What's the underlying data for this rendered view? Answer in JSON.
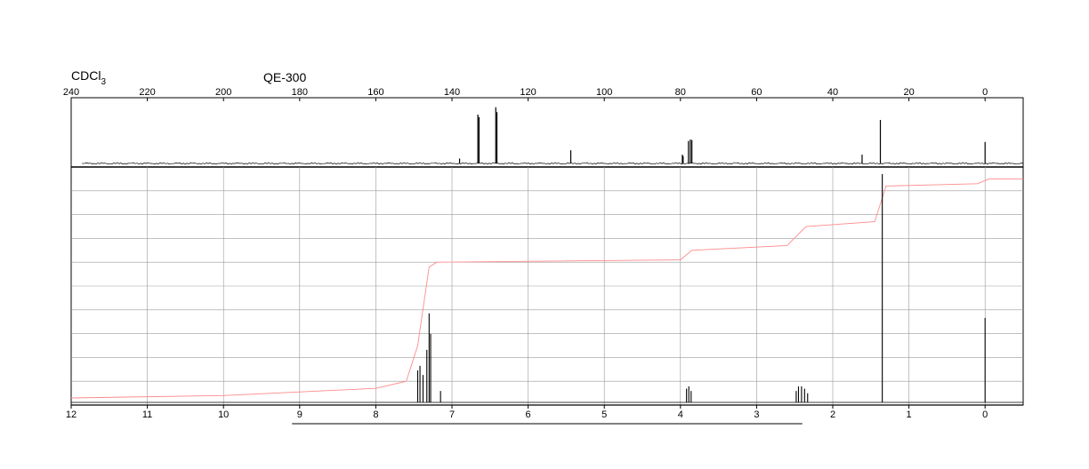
{
  "chart_data": [
    {
      "type": "line",
      "title": "",
      "xlabel": "",
      "ylabel": "",
      "xlim": [
        240,
        -10
      ],
      "x_ticks": [
        240,
        220,
        200,
        180,
        160,
        140,
        120,
        100,
        80,
        60,
        40,
        20,
        0
      ],
      "grid": false,
      "peaks": [
        {
          "x": 138.0,
          "h": 0.1
        },
        {
          "x": 133.2,
          "h": 1.0
        },
        {
          "x": 132.9,
          "h": 0.95
        },
        {
          "x": 128.5,
          "h": 1.15
        },
        {
          "x": 128.2,
          "h": 1.05
        },
        {
          "x": 108.8,
          "h": 0.27
        },
        {
          "x": 79.5,
          "h": 0.18
        },
        {
          "x": 79.3,
          "h": 0.15
        },
        {
          "x": 77.9,
          "h": 0.46
        },
        {
          "x": 77.4,
          "h": 0.49
        },
        {
          "x": 77.0,
          "h": 0.48
        },
        {
          "x": 32.3,
          "h": 0.18
        },
        {
          "x": 27.5,
          "h": 0.89
        },
        {
          "x": 0.0,
          "h": 0.44
        }
      ]
    },
    {
      "type": "line",
      "title": "",
      "xlabel": "",
      "ylabel": "",
      "xlim": [
        12,
        -0.5
      ],
      "x_ticks": [
        12,
        11,
        10,
        9,
        8,
        7,
        6,
        5,
        4,
        3,
        2,
        1,
        0
      ],
      "grid": true,
      "peaks": [
        {
          "x": 7.45,
          "h": 0.14
        },
        {
          "x": 7.42,
          "h": 0.16
        },
        {
          "x": 7.38,
          "h": 0.12
        },
        {
          "x": 7.33,
          "h": 0.23
        },
        {
          "x": 7.3,
          "h": 0.39
        },
        {
          "x": 7.28,
          "h": 0.3
        },
        {
          "x": 7.15,
          "h": 0.05
        },
        {
          "x": 3.92,
          "h": 0.06
        },
        {
          "x": 3.89,
          "h": 0.07
        },
        {
          "x": 3.86,
          "h": 0.05
        },
        {
          "x": 2.48,
          "h": 0.05
        },
        {
          "x": 2.45,
          "h": 0.07
        },
        {
          "x": 2.41,
          "h": 0.07
        },
        {
          "x": 2.37,
          "h": 0.06
        },
        {
          "x": 2.33,
          "h": 0.04
        },
        {
          "x": 1.35,
          "h": 1.0
        },
        {
          "x": 0.0,
          "h": 0.37
        }
      ],
      "integral_curve": [
        [
          12.0,
          0.03
        ],
        [
          10.0,
          0.04
        ],
        [
          8.0,
          0.07
        ],
        [
          7.6,
          0.1
        ],
        [
          7.45,
          0.25
        ],
        [
          7.3,
          0.58
        ],
        [
          7.2,
          0.6
        ],
        [
          4.0,
          0.61
        ],
        [
          3.85,
          0.65
        ],
        [
          2.6,
          0.67
        ],
        [
          2.35,
          0.75
        ],
        [
          1.45,
          0.77
        ],
        [
          1.3,
          0.92
        ],
        [
          0.1,
          0.93
        ],
        [
          -0.05,
          0.95
        ],
        [
          -0.5,
          0.95
        ]
      ],
      "integral_color": "#ff8a8a"
    }
  ],
  "header": {
    "solvent": "CDCl",
    "solvent_subscript": "3",
    "instrument": "QE-300"
  }
}
